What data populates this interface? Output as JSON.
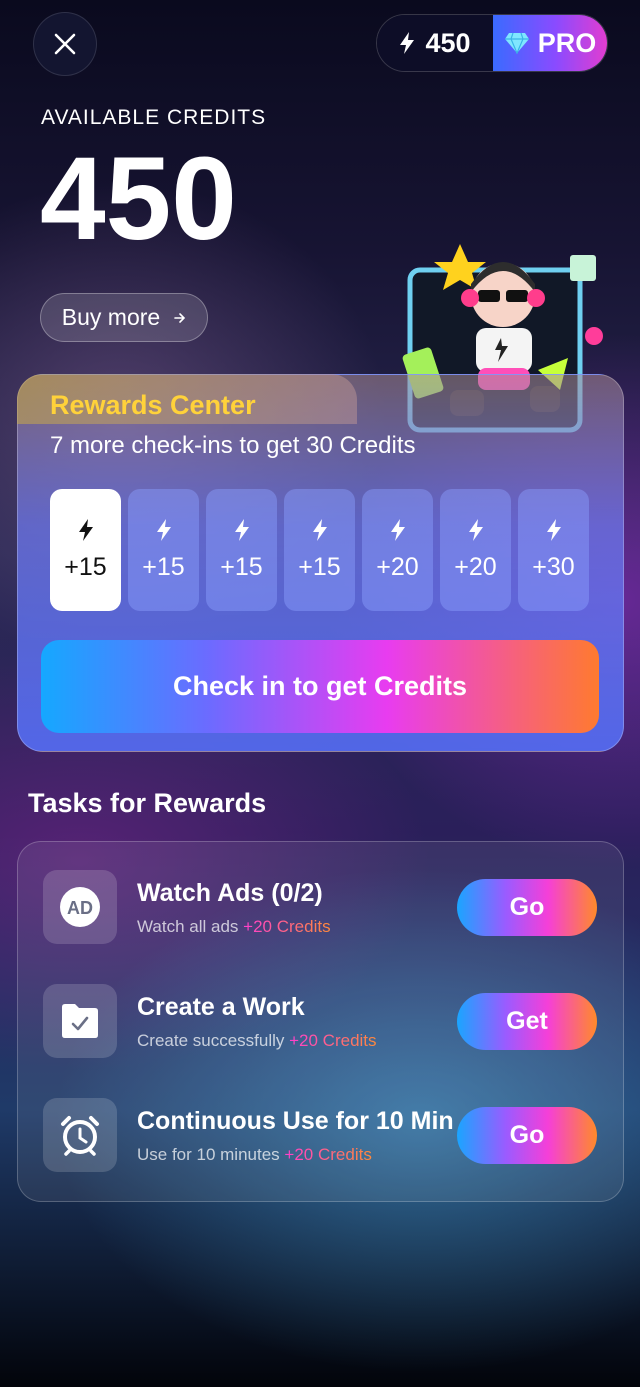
{
  "header": {
    "close_icon": "close-icon",
    "credit_count": "450",
    "pro_label": "PRO",
    "accent_gradient": [
      "#3a6bff",
      "#8a4bff",
      "#e23dd0"
    ]
  },
  "credits": {
    "label": "AVAILABLE CREDITS",
    "value": "450",
    "buy_more": "Buy more"
  },
  "rewards": {
    "title": "Rewards Center",
    "subtitle": "7 more check-ins to get 30 Credits",
    "days": [
      {
        "amount": "+15",
        "active": true
      },
      {
        "amount": "+15",
        "active": false
      },
      {
        "amount": "+15",
        "active": false
      },
      {
        "amount": "+15",
        "active": false
      },
      {
        "amount": "+20",
        "active": false
      },
      {
        "amount": "+20",
        "active": false
      },
      {
        "amount": "+30",
        "active": false
      }
    ],
    "checkin_button": "Check in to get Credits"
  },
  "tasks": {
    "title": "Tasks for Rewards",
    "items": [
      {
        "icon": "ad-icon",
        "title": "Watch Ads  (0/2)",
        "desc": "Watch all ads",
        "reward": "+20 Credits",
        "button": "Go"
      },
      {
        "icon": "folder-check-icon",
        "title": "Create a Work",
        "desc": "Create successfully",
        "reward": "+20 Credits",
        "button": "Get"
      },
      {
        "icon": "alarm-clock-icon",
        "title": "Continuous Use for 10 Min",
        "desc": "Use for 10 minutes",
        "reward": "+20 Credits",
        "button": "Go"
      }
    ]
  }
}
